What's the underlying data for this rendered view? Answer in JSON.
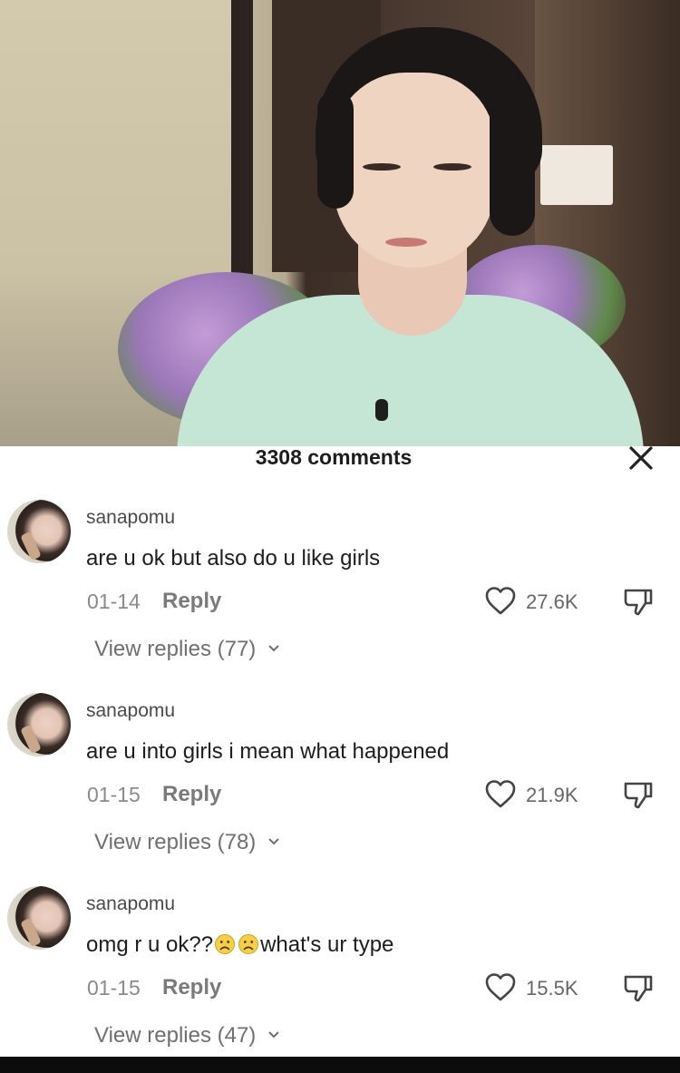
{
  "sheet": {
    "title": "3308 comments"
  },
  "comments": [
    {
      "username": "sanapomu",
      "text": "are u ok but also do u like girls",
      "date": "01-14",
      "reply_label": "Reply",
      "likes": "27.6K",
      "view_replies": "View replies (77)"
    },
    {
      "username": "sanapomu",
      "text": "are u into girls i mean what happened",
      "date": "01-15",
      "reply_label": "Reply",
      "likes": "21.9K",
      "view_replies": "View replies (78)"
    },
    {
      "username": "sanapomu",
      "text_before": "omg r u ok??",
      "text_after": "what's ur type",
      "emojis": [
        "frowning-face-emoji",
        "frowning-face-emoji"
      ],
      "date": "01-15",
      "reply_label": "Reply",
      "likes": "15.5K",
      "view_replies": "View replies (47)"
    }
  ],
  "colors": {
    "text": "#1d1d1d",
    "muted": "#8a8a8a",
    "emoji_yellow": "#f6cf47"
  }
}
